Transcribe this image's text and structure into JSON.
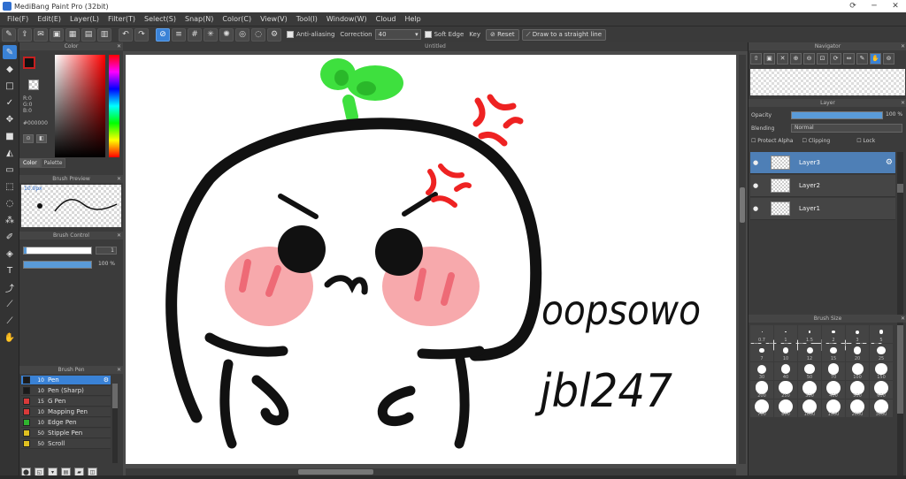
{
  "window": {
    "title": "MediBang Paint Pro (32bit)",
    "controls": [
      "⟳",
      "─",
      "✕"
    ]
  },
  "menu": [
    "File(F)",
    "Edit(E)",
    "Layer(L)",
    "Filter(T)",
    "Select(S)",
    "Snap(N)",
    "Color(C)",
    "View(V)",
    "Tool(I)",
    "Window(W)",
    "Cloud",
    "Help"
  ],
  "toolbar": {
    "antialias_label": "Anti-aliasing",
    "correction_label": "Correction",
    "correction_value": "40",
    "soft_edge_label": "Soft Edge",
    "key_label": "Key",
    "reset_label": "Reset",
    "stroke_label": "Draw to a straight line"
  },
  "canvas": {
    "tab_title": "Untitled"
  },
  "panels": {
    "color": {
      "title": "Color",
      "rgb": [
        "R:0",
        "G:0",
        "B:0"
      ],
      "hex": "#000000",
      "tabs": [
        "Color",
        "Palette"
      ]
    },
    "brush_preview": {
      "title": "Brush Preview",
      "size": "10.0px"
    },
    "brush_control": {
      "title": "Brush Control",
      "size_value": "1",
      "opacity_value": "100 %"
    },
    "brush": {
      "title": "Brush Pen",
      "items": [
        {
          "size": "10",
          "name": "Pen",
          "color": "#1a1a1a"
        },
        {
          "size": "10",
          "name": "Pen (Sharp)",
          "color": "#1a1a1a"
        },
        {
          "size": "15",
          "name": "G Pen",
          "color": "#d93a3a"
        },
        {
          "size": "10",
          "name": "Mapping Pen",
          "color": "#d93a3a"
        },
        {
          "size": "10",
          "name": "Edge Pen",
          "color": "#2fb52f"
        },
        {
          "size": "50",
          "name": "Stipple Pen",
          "color": "#e0c020"
        },
        {
          "size": "50",
          "name": "Scroll",
          "color": "#e0c020"
        }
      ]
    },
    "navigator": {
      "title": "Navigator"
    },
    "layer": {
      "title": "Layer",
      "opacity_label": "Opacity",
      "opacity_value": "100 %",
      "blending_label": "Blending",
      "blending_value": "Normal",
      "checks": [
        "Protect Alpha",
        "Clipping",
        "Lock"
      ],
      "layers": [
        "Layer3",
        "Layer2",
        "Layer1"
      ]
    },
    "brush_size": {
      "title": "Brush Size",
      "sizes": [
        "0.7",
        "1",
        "1.5",
        "2",
        "3",
        "5",
        "7",
        "10",
        "12",
        "15",
        "20",
        "25",
        "30",
        "40",
        "50",
        "70",
        "100",
        "150",
        "200",
        "250",
        "300",
        "400",
        "500",
        "600",
        "700",
        "800",
        "1000",
        "1500",
        "2000",
        "3000"
      ]
    }
  },
  "artwork": {
    "text_line1": "oopsowo",
    "text_line2": "jbl247",
    "colors": {
      "outline": "#111111",
      "sprout": "#3ee03e",
      "sprout_dark": "#2ab82a",
      "blush": "#f7a9ac",
      "blush_mark": "#ee6a76",
      "anger": "#ee2222"
    }
  },
  "theme": {
    "accent": "#3a82d6",
    "panel": "#3b3b3b"
  }
}
